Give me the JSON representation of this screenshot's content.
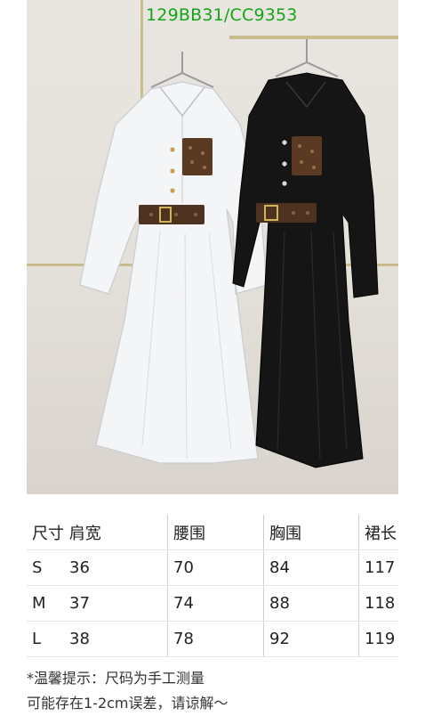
{
  "watermark": "129BB31/CC9353",
  "table": {
    "headers": [
      "尺寸 肩宽",
      "腰围",
      "胸围",
      "裙长"
    ],
    "rows": [
      {
        "size": "S",
        "shoulder": "36",
        "waist": "70",
        "bust": "84",
        "length": "117"
      },
      {
        "size": "M",
        "shoulder": "37",
        "waist": "74",
        "bust": "88",
        "length": "118"
      },
      {
        "size": "L",
        "shoulder": "38",
        "waist": "78",
        "bust": "92",
        "length": "119"
      }
    ]
  },
  "note": {
    "line1": "*温馨提示：尺码为手工测量",
    "line2": "可能存在1-2cm误差，请谅解～"
  },
  "colors": {
    "watermark": "#16a516",
    "white_dress": "#f4f5f7",
    "black_dress": "#151515",
    "monogram": "#5a3a22"
  }
}
